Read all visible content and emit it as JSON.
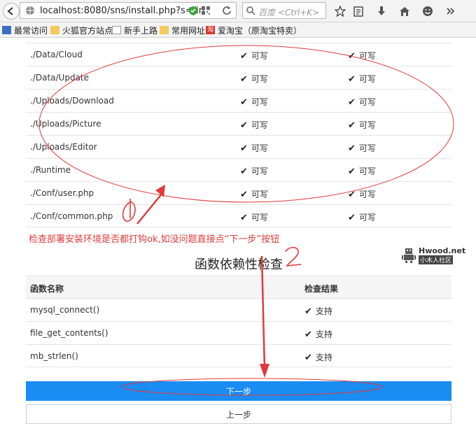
{
  "browser": {
    "url": "localhost:8080/sns/install.php?s=/in",
    "search_placeholder": "百度 <Ctrl+K>"
  },
  "bookmarks": [
    {
      "label": "最常访问"
    },
    {
      "label": "火狐官方站点"
    },
    {
      "label": "新手上路"
    },
    {
      "label": "常用网址"
    },
    {
      "label": "爱淘宝（原淘宝特卖）"
    }
  ],
  "dir_check": {
    "rows": [
      {
        "path": "./Data/Cloud",
        "current": "可写",
        "required": "可写"
      },
      {
        "path": "./Data/Update",
        "current": "可写",
        "required": "可写"
      },
      {
        "path": "./Uploads/Download",
        "current": "可写",
        "required": "可写"
      },
      {
        "path": "./Uploads/Picture",
        "current": "可写",
        "required": "可写"
      },
      {
        "path": "./Uploads/Editor",
        "current": "可写",
        "required": "可写"
      },
      {
        "path": "./Runtime",
        "current": "可写",
        "required": "可写"
      },
      {
        "path": "./Conf/user.php",
        "current": "可写",
        "required": "可写"
      },
      {
        "path": "./Conf/common.php",
        "current": "可写",
        "required": "可写"
      }
    ]
  },
  "annotation": {
    "note": "检查部署安装环境是否都打钩ok,如没问题直接点“下一步”按钮",
    "marker1": "①",
    "marker2": "②"
  },
  "func_check": {
    "title": "函数依赖性检查",
    "headers": [
      "函数名称",
      "检查结果"
    ],
    "rows": [
      {
        "name": "mysql_connect()",
        "result": "支持"
      },
      {
        "name": "file_get_contents()",
        "result": "支持"
      },
      {
        "name": "mb_strlen()",
        "result": "支持"
      }
    ]
  },
  "buttons": {
    "next": "下一步",
    "prev": "上一步"
  },
  "watermark": {
    "brand": "Hwood.net",
    "sub": "小木人社区"
  },
  "colors": {
    "primary_button": "#1a8cf2",
    "annotation_red": "#e03a3a"
  }
}
